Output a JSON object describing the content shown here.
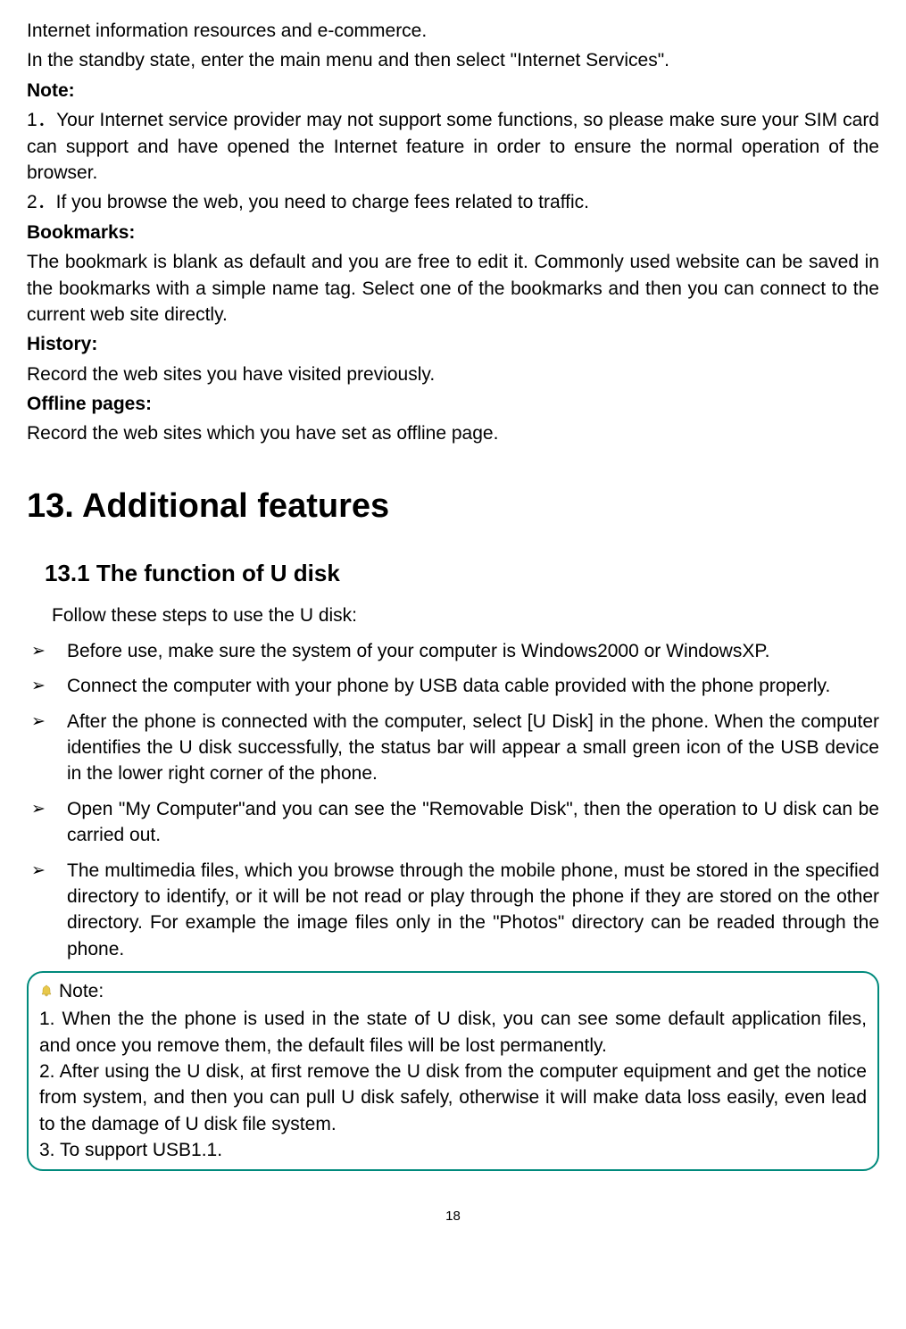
{
  "intro": {
    "p1": "Internet information resources and e-commerce.",
    "p2": "In the standby state, enter the main menu and then select \"Internet Services\".",
    "noteLabel": "Note:",
    "note1": "1．Your Internet service provider may not support some functions, so please make sure your SIM card can support and have opened the Internet feature in order to ensure the normal operation of the browser.",
    "note2": "2．If you browse the web, you need to charge fees related to traffic.",
    "bookmarksLabel": "Bookmarks:",
    "bookmarksText": "The bookmark is blank as default and you are free to edit it. Commonly used website can be saved in the bookmarks with a simple name tag.   Select one of the bookmarks and then you can connect to the current web site directly.",
    "historyLabel": "History:",
    "historyText": "Record the web sites you have visited previously.",
    "offlineLabel": "Offline pages:",
    "offlineText": "Record the web sites which you have set as offline page."
  },
  "h1": "13. Additional features",
  "h2": "13.1 The function of U disk",
  "followSteps": "Follow these steps to use the U disk:",
  "bullets": {
    "b1": "Before use, make sure the system of your computer is Windows2000 or WindowsXP.",
    "b2": "Connect the computer with your phone by USB data cable provided with the phone properly.",
    "b3": "After the phone is connected with the computer, select [U Disk] in the phone. When the computer identifies the U disk successfully, the status bar will appear a small green icon of the USB device in the lower right corner of the phone.",
    "b4": "Open \"My Computer\"and you can see the \"Removable Disk\", then the operation to U disk can be carried out.",
    "b5": "The multimedia files, which you browse through the mobile phone, must be stored in the specified directory to identify, or it will be not read or play through the phone if they are stored on the other directory. For example the image files only in the \"Photos\" directory can be readed through the phone."
  },
  "noteBox": {
    "title": " Note:",
    "n1": "1. When the the phone is used in the state of U disk, you can see some default application files, and once you remove them, the default files will be lost permanently.",
    "n2": "2. After using the U disk, at first remove the U disk from the computer equipment and get the notice from system, and then you can pull U disk safely, otherwise it will make data loss easily, even lead to the damage of U disk file system.",
    "n3": "3. To support USB1.1."
  },
  "pageNumber": "18"
}
